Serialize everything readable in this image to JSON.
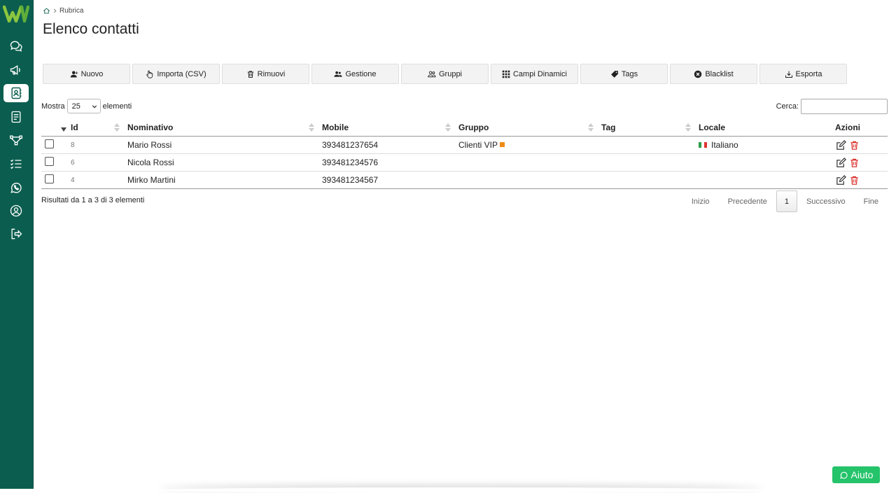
{
  "colors": {
    "sidebar": "#0b5e4f",
    "accent": "#25c36a",
    "group": "#ef8a17",
    "delete": "#d9322e"
  },
  "sidebar": {
    "items": [
      {
        "icon": "chat-icon",
        "active": false
      },
      {
        "icon": "megaphone-icon",
        "active": false
      },
      {
        "icon": "contacts-icon",
        "active": true
      },
      {
        "icon": "document-icon",
        "active": false
      },
      {
        "icon": "workflow-icon",
        "active": false
      },
      {
        "icon": "checklist-icon",
        "active": false
      },
      {
        "icon": "whatsapp-icon",
        "active": false
      },
      {
        "icon": "user-icon",
        "active": false
      },
      {
        "icon": "logout-icon",
        "active": false
      }
    ]
  },
  "breadcrumb": {
    "current": "Rubrica"
  },
  "page": {
    "title": "Elenco contatti"
  },
  "toolbar": {
    "buttons": [
      {
        "label": "Nuovo",
        "icon": "add-user-icon"
      },
      {
        "label": "Importa (CSV)",
        "icon": "hand-pointer-icon"
      },
      {
        "label": "Rimuovi",
        "icon": "trash-icon"
      },
      {
        "label": "Gestione",
        "icon": "users-icon"
      },
      {
        "label": "Gruppi",
        "icon": "group-icon"
      },
      {
        "label": "Campi Dinamici",
        "icon": "grid-icon"
      },
      {
        "label": "Tags",
        "icon": "tag-icon"
      },
      {
        "label": "Blacklist",
        "icon": "ban-icon"
      },
      {
        "label": "Esporta",
        "icon": "download-icon"
      }
    ]
  },
  "length": {
    "prefix": "Mostra",
    "value": "25",
    "suffix": "elementi"
  },
  "search": {
    "label": "Cerca:",
    "value": ""
  },
  "table": {
    "columns": [
      "Id",
      "Nominativo",
      "Mobile",
      "Gruppo",
      "Tag",
      "Locale",
      "Azioni"
    ],
    "rows": [
      {
        "id": "8",
        "name": "Mario Rossi",
        "mobile": "393481237654",
        "group": "Clienti VIP",
        "tag": "",
        "locale": "Italiano"
      },
      {
        "id": "6",
        "name": "Nicola Rossi",
        "mobile": "393481234576",
        "group": "",
        "tag": "",
        "locale": ""
      },
      {
        "id": "4",
        "name": "Mirko Martini",
        "mobile": "393481234567",
        "group": "",
        "tag": "",
        "locale": ""
      }
    ]
  },
  "info": "Risultati da 1 a 3 di 3 elementi",
  "pagination": {
    "first": "Inizio",
    "prev": "Precedente",
    "current": "1",
    "next": "Successivo",
    "last": "Fine"
  },
  "help": {
    "label": "Aiuto"
  }
}
